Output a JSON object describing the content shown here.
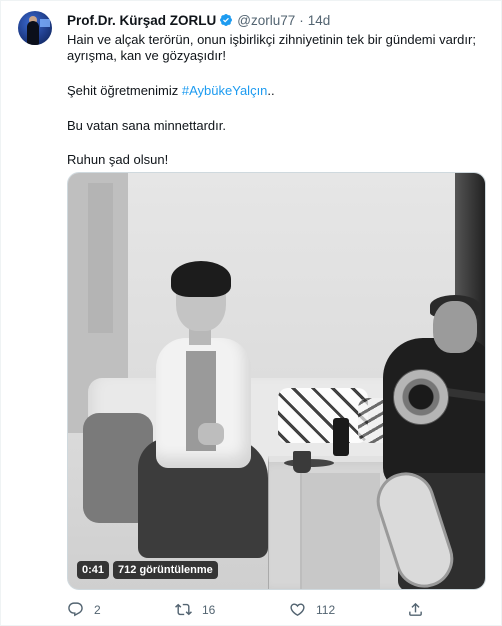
{
  "tweet": {
    "author_name": "Prof.Dr. Kürşad ZORLU",
    "handle": "@zorlu77",
    "separator": "·",
    "time": "14d",
    "text_line1": "Hain ve alçak terörün, onun işbirlikçi zihniyetinin tek bir gündemi vardır;",
    "text_line2": "ayrışma, kan ve gözyaşıdır!",
    "text_line3_prefix": "Şehit öğretmenimiz ",
    "hashtag": "#AybükeYalçın",
    "text_line3_suffix": "..",
    "text_line4": "Bu vatan sana minnettardır.",
    "text_line5": "Ruhun şad olsun!"
  },
  "video": {
    "duration": "0:41",
    "views": "712 görüntülenme"
  },
  "actions": {
    "reply_count": "2",
    "retweet_count": "16",
    "like_count": "112"
  },
  "colors": {
    "link": "#1d9bf0",
    "muted": "#536471",
    "text": "#0f1419",
    "verified": "#1d9bf0"
  },
  "icons": [
    "verified-badge-icon",
    "reply-icon",
    "retweet-icon",
    "like-icon",
    "share-icon"
  ]
}
